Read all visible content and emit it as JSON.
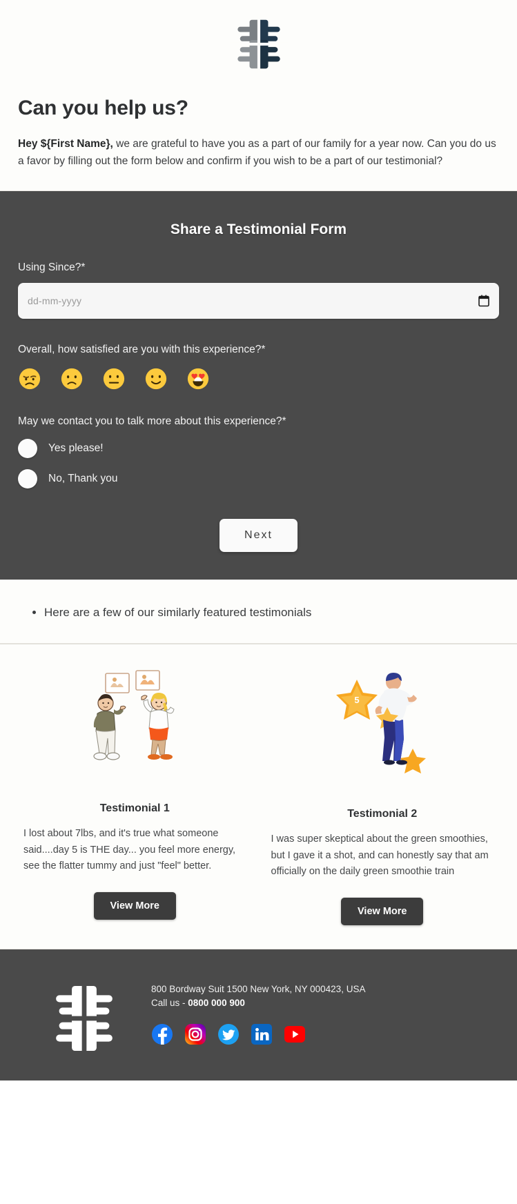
{
  "brand": {
    "logo_icon": "pinwheel-f-logo",
    "logo_colors": [
      "#2b4257",
      "#7d8286",
      "#1f3245",
      "#9aa0a4"
    ]
  },
  "hero": {
    "title": "Can you help us?",
    "greeting_bold": "Hey ${First Name},",
    "body": " we are grateful to have you as a part of our family for a year now. Can you do us a favor by filling out the form below and confirm if you wish to be a part of our testimonial?"
  },
  "form": {
    "title": "Share a Testimonial Form",
    "date_question": "Using Since?*",
    "date_placeholder": "dd-mm-yyyy",
    "date_value": "",
    "date_icon": "calendar-icon",
    "satisfaction_question": "Overall, how satisfied are you with this experience?*",
    "emojis": [
      {
        "name": "emoji-disappointed",
        "label": "Disappointed"
      },
      {
        "name": "emoji-slightly-frowning",
        "label": "Slightly frowning"
      },
      {
        "name": "emoji-neutral",
        "label": "Neutral"
      },
      {
        "name": "emoji-slightly-smiling",
        "label": "Slightly smiling"
      },
      {
        "name": "emoji-heart-eyes",
        "label": "Heart eyes"
      }
    ],
    "contact_question": "May we contact you to talk more about this experience?*",
    "radios": [
      {
        "label": "Yes please!",
        "selected": false
      },
      {
        "label": "No, Thank you",
        "selected": false
      }
    ],
    "next_label": "Next"
  },
  "note": {
    "items": [
      "Here are a few of our similarly featured testimonials"
    ]
  },
  "testimonials": [
    {
      "art_icon": "two-people-with-speech-cards-illustration",
      "title": "Testimonial 1",
      "text": "I lost about 7lbs, and it's true what someone said....day 5 is THE day... you feel more energy, see the flatter tummy and just \"feel\" better.",
      "button": "View More"
    },
    {
      "art_icon": "person-with-gold-star-illustration",
      "title": "Testimonial 2",
      "text": "I was super skeptical about the green smoothies, but I gave it a shot, and can honestly say that am officially on the daily green smoothie train",
      "button": "View More"
    }
  ],
  "footer": {
    "logo_icon": "pinwheel-f-logo-white",
    "address": "800 Bordway Suit 1500 New York, NY 000423, USA",
    "call_prefix": "Call us - ",
    "phone": "0800 000 900",
    "social": [
      {
        "name": "facebook-icon",
        "color": "#1877F2",
        "label": "Facebook"
      },
      {
        "name": "instagram-icon",
        "color": "#E1306C",
        "label": "Instagram"
      },
      {
        "name": "twitter-icon",
        "color": "#1DA1F2",
        "label": "Twitter"
      },
      {
        "name": "linkedin-icon",
        "color": "#0A66C2",
        "label": "LinkedIn"
      },
      {
        "name": "youtube-icon",
        "color": "#FF0000",
        "label": "YouTube"
      }
    ]
  },
  "colors": {
    "panel_dark": "#4a4a4a",
    "page_bg": "#fdfdfb",
    "text_dark": "#2f3133",
    "button_dark": "#3c3c3c"
  }
}
